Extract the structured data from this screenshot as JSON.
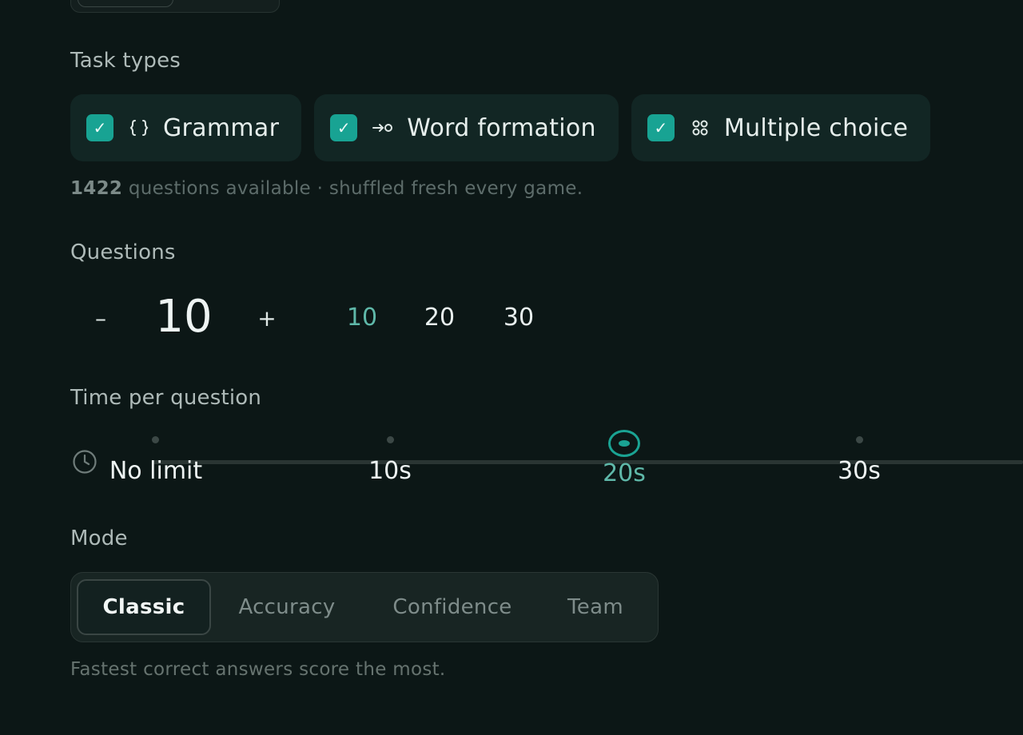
{
  "task_types": {
    "title": "Task types",
    "items": [
      {
        "label": "Grammar",
        "checked": true,
        "icon": "braces-icon"
      },
      {
        "label": "Word formation",
        "checked": true,
        "icon": "arrow-circle-icon"
      },
      {
        "label": "Multiple choice",
        "checked": true,
        "icon": "grid-dots-icon"
      }
    ],
    "available_count": "1422",
    "available_text": " questions available · shuffled fresh every game."
  },
  "questions": {
    "title": "Questions",
    "minus_label": "–",
    "plus_label": "+",
    "value": "10",
    "presets": [
      "10",
      "20",
      "30"
    ],
    "active_preset": "10"
  },
  "time": {
    "title": "Time per question",
    "options": [
      "No limit",
      "10s",
      "20s",
      "30s"
    ],
    "selected": "20s"
  },
  "mode": {
    "title": "Mode",
    "options": [
      "Classic",
      "Accuracy",
      "Confidence",
      "Team"
    ],
    "selected": "Classic",
    "description": "Fastest correct answers score the most."
  },
  "colors": {
    "accent": "#18a393",
    "accent_text": "#5fb8a9",
    "background": "#0c1716"
  }
}
